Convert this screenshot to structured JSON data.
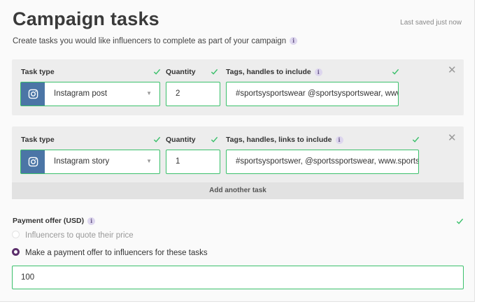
{
  "header": {
    "title": "Campaign tasks",
    "last_saved": "Last saved just now",
    "subtitle": "Create tasks you would like influencers to complete as part of your campaign"
  },
  "info_glyph": "i",
  "tasks": [
    {
      "type_label": "Task type",
      "type_value": "Instagram post",
      "quantity_label": "Quantity",
      "quantity_value": "2",
      "tags_label": "Tags, handles to include",
      "tags_value": "#sportsysportswear @sportsysportswear, www"
    },
    {
      "type_label": "Task type",
      "type_value": "Instagram story",
      "quantity_label": "Quantity",
      "quantity_value": "1",
      "tags_label": "Tags, handles, links to include",
      "tags_value": "#sportsysportswer, @sportssportswear, www.sportsysportswear.com"
    }
  ],
  "add_task_label": "Add another task",
  "payment": {
    "label": "Payment offer (USD)",
    "options": [
      {
        "label": "Influencers to quote their price",
        "selected": false
      },
      {
        "label": "Make a payment offer to influencers for these tasks",
        "selected": true
      }
    ],
    "offer_value": "100"
  },
  "colors": {
    "valid_green": "#3bc06b",
    "instagram_blue": "#4b75a6",
    "radio_selected": "#5c2f6c"
  },
  "icons": {
    "task_type": "instagram-icon",
    "validation": "checkmark-icon",
    "remove": "close-icon",
    "dropdown": "chevron-down-icon",
    "info": "info-icon"
  }
}
